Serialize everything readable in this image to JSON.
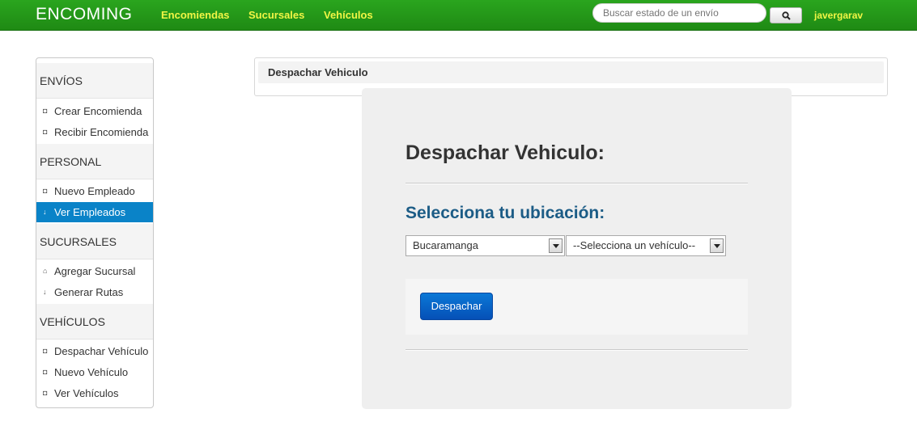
{
  "navbar": {
    "brand": "ENCOMING",
    "links": [
      "Encomiendas",
      "Sucursales",
      "Vehículos"
    ],
    "search_placeholder": "Buscar estado de un envío",
    "search_icon": "search-icon",
    "user": "javergarav"
  },
  "sidebar": {
    "sections": [
      {
        "header": "ENVÍOS",
        "items": [
          "Crear Encomienda",
          "Recibir Encomienda"
        ]
      },
      {
        "header": "PERSONAL",
        "items": [
          "Nuevo Empleado",
          "Ver Empleados"
        ]
      },
      {
        "header": "SUCURSALES",
        "items": [
          "Agregar Sucursal",
          "Generar Rutas"
        ]
      },
      {
        "header": "VEHÍCULOS",
        "items": [
          "Despachar Vehículo",
          "Nuevo Vehículo",
          "Ver Vehículos"
        ]
      }
    ],
    "active_item": "Ver Empleados"
  },
  "breadcrumb": {
    "title": "Despachar Vehiculo"
  },
  "form": {
    "title": "Despachar Vehiculo:",
    "subtitle": "Selecciona tu ubicación:",
    "location_select": "Bucaramanga",
    "vehicle_select": "--Selecciona un vehículo--",
    "submit_label": "Despachar"
  },
  "colors": {
    "navbar_green": "#1f8a14",
    "nav_link_yellow": "#f1f545",
    "active_blue": "#0a83c8",
    "subtitle_blue": "#1c5c86",
    "button_blue": "#0550b7"
  }
}
